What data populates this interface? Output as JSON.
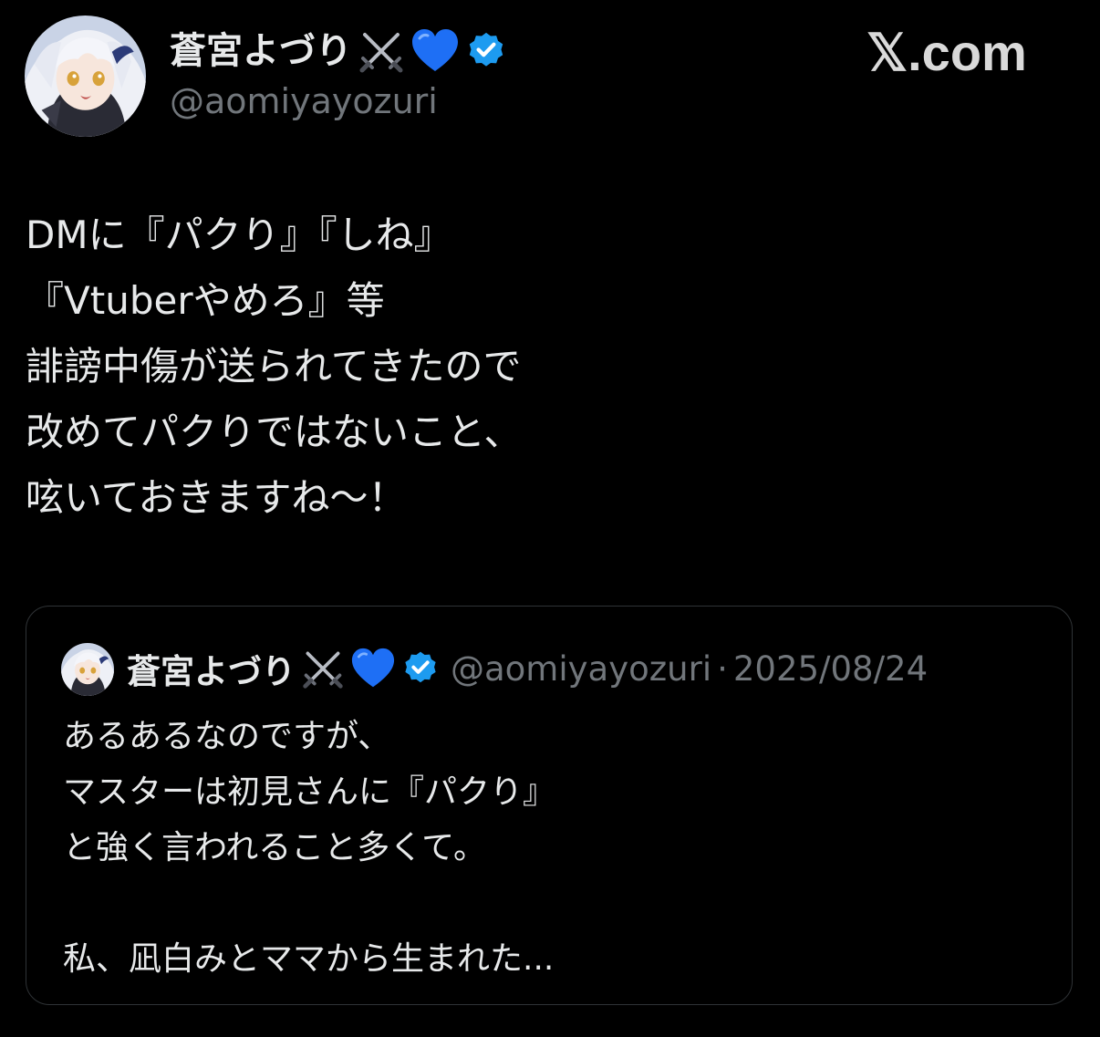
{
  "author": {
    "display_name": "蒼宮よづり",
    "handle": "@aomiyayozuri",
    "avatar_icon": "avatar-anime-girl-white-hair",
    "emojis": [
      "crossed-swords-icon",
      "blue-heart-icon"
    ],
    "verified_icon": "verified-badge-icon"
  },
  "brand": {
    "logo_text": "𝕏.com"
  },
  "tweet": {
    "lines": [
      "DMに『パクり』『しね』",
      "『Vtuberやめろ』等",
      "誹謗中傷が送られてきたので",
      "改めてパクりではないこと、",
      "呟いておきますね〜！"
    ]
  },
  "quote": {
    "display_name": "蒼宮よづり",
    "handle": "@aomiyayozuri",
    "separator": "·",
    "date": "2025/08/24",
    "lines": [
      "あるあるなのですが、",
      "マスターは初見さんに『パクり』",
      "と強く言われること多くて。",
      "",
      "私、凪白みとママから生まれた..."
    ]
  },
  "colors": {
    "background": "#000000",
    "text_primary": "#e7e9ea",
    "text_secondary": "#71767b",
    "border": "#2f3336",
    "verified_blue": "#1d9bf0",
    "heart_blue": "#1e6ff5"
  }
}
